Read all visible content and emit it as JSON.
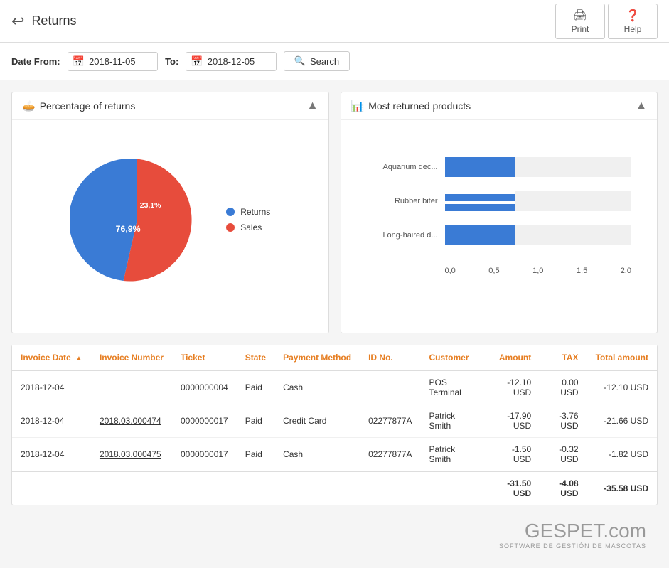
{
  "header": {
    "back_icon": "↩",
    "title": "Returns",
    "print_label": "Print",
    "help_label": "Help",
    "print_icon": "🖨",
    "help_icon": "?"
  },
  "toolbar": {
    "date_from_label": "Date From:",
    "date_from_value": "2018-11-05",
    "to_label": "To:",
    "date_to_value": "2018-12-05",
    "search_label": "Search"
  },
  "pie_chart": {
    "title": "Percentage of returns",
    "returns_pct": "23,1%",
    "sales_pct": "76,9%",
    "returns_color": "#3a7bd5",
    "sales_color": "#e74c3c",
    "legend": [
      {
        "label": "Returns",
        "color": "#3a7bd5"
      },
      {
        "label": "Sales",
        "color": "#e74c3c"
      }
    ]
  },
  "bar_chart": {
    "title": "Most returned products",
    "bars": [
      {
        "label": "Aquarium dec...",
        "value": 0.75,
        "max": 2.0
      },
      {
        "label": "Rubber biter",
        "value": 0.75,
        "max": 2.0
      },
      {
        "label": "Long-haired d...",
        "value": 0.75,
        "max": 2.0
      }
    ],
    "x_labels": [
      "0,0",
      "0,5",
      "1,0",
      "1,5",
      "2,0"
    ]
  },
  "table": {
    "columns": [
      {
        "id": "invoice_date",
        "label": "Invoice Date",
        "sortable": true
      },
      {
        "id": "invoice_number",
        "label": "Invoice Number"
      },
      {
        "id": "ticket",
        "label": "Ticket"
      },
      {
        "id": "state",
        "label": "State"
      },
      {
        "id": "payment_method",
        "label": "Payment Method"
      },
      {
        "id": "id_no",
        "label": "ID No."
      },
      {
        "id": "customer",
        "label": "Customer"
      },
      {
        "id": "amount",
        "label": "Amount",
        "right": true
      },
      {
        "id": "tax",
        "label": "TAX",
        "right": true
      },
      {
        "id": "total_amount",
        "label": "Total amount",
        "right": true
      }
    ],
    "rows": [
      {
        "invoice_date": "2018-12-04",
        "invoice_number": "",
        "ticket": "0000000004",
        "state": "Paid",
        "payment_method": "Cash",
        "id_no": "",
        "customer": "POS Terminal",
        "customer_link": false,
        "customer_pos": true,
        "amount": "-12.10 USD",
        "tax": "0.00 USD",
        "total_amount": "-12.10 USD"
      },
      {
        "invoice_date": "2018-12-04",
        "invoice_number": "2018.03.000474",
        "ticket": "0000000017",
        "state": "Paid",
        "payment_method": "Credit Card",
        "id_no": "02277877A",
        "customer": "Patrick Smith",
        "customer_link": false,
        "customer_pos": false,
        "amount": "-17.90 USD",
        "tax": "-3.76 USD",
        "total_amount": "-21.66 USD"
      },
      {
        "invoice_date": "2018-12-04",
        "invoice_number": "2018.03.000475",
        "ticket": "0000000017",
        "state": "Paid",
        "payment_method": "Cash",
        "id_no": "02277877A",
        "customer": "Patrick Smith",
        "customer_link": false,
        "customer_pos": false,
        "amount": "-1.50 USD",
        "tax": "-0.32 USD",
        "total_amount": "-1.82 USD"
      }
    ],
    "totals": {
      "amount": "-31.50 USD",
      "tax": "-4.08 USD",
      "total_amount": "-35.58 USD"
    }
  },
  "footer": {
    "brand": "GESPET",
    "brand_suffix": ".com",
    "tagline": "SOFTWARE DE GESTIÓN DE MASCOTAS"
  }
}
